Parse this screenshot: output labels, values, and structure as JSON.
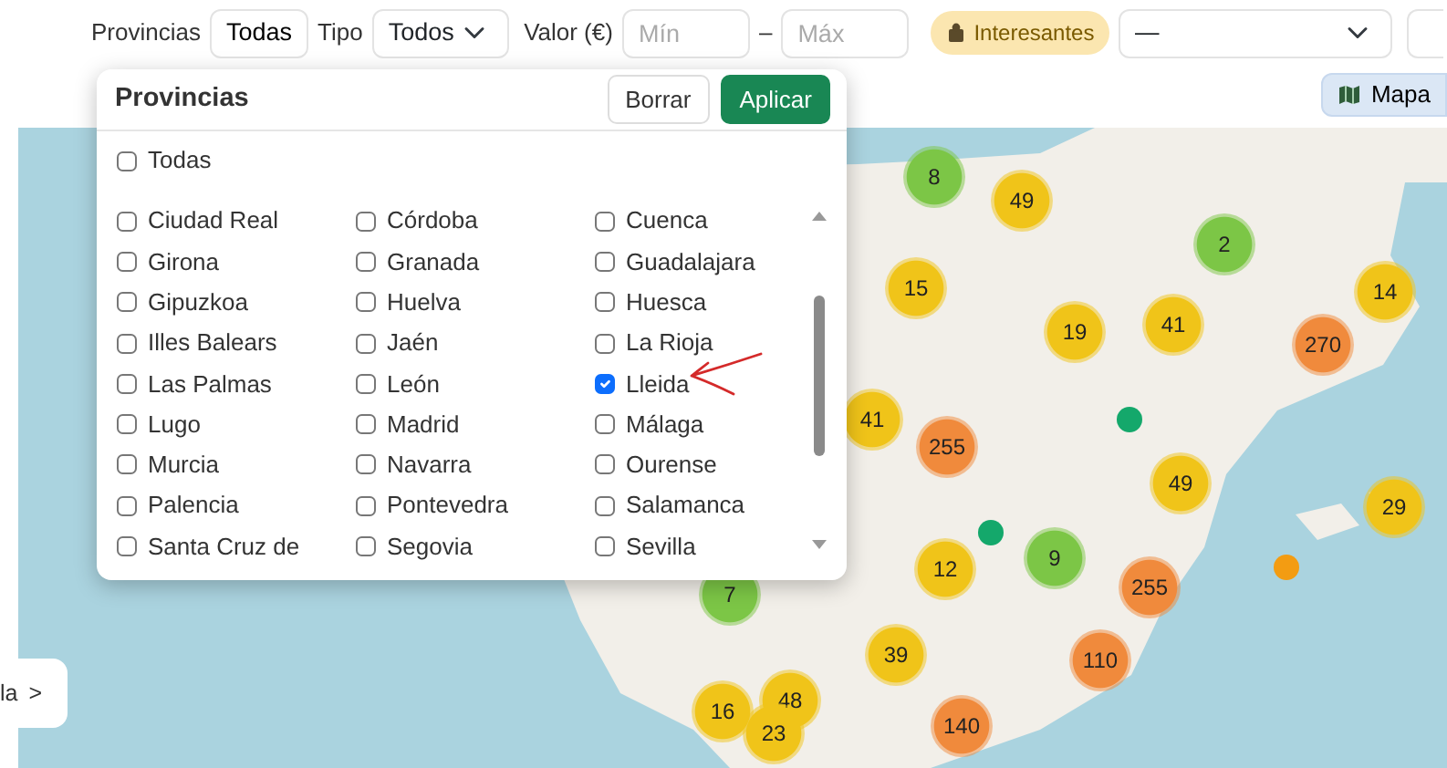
{
  "toolbar": {
    "provinces_label": "Provincias",
    "provinces_button": "Todas",
    "type_label": "Tipo",
    "type_select": "Todos",
    "value_label": "Valor (€)",
    "min_placeholder": "Mín",
    "range_separator": "–",
    "max_placeholder": "Máx",
    "interesting_badge": "Interesantes",
    "sort_select": "—"
  },
  "map_button": "Mapa",
  "provinces_panel": {
    "title": "Provincias",
    "buttons": [
      {
        "label": "Borrar",
        "kind": "secondary"
      },
      {
        "label": "Aplicar",
        "kind": "primary"
      }
    ],
    "all_option": {
      "label": "Todas",
      "checked": false
    },
    "options": [
      {
        "label": "Ciudad Real",
        "checked": false
      },
      {
        "label": "Córdoba",
        "checked": false
      },
      {
        "label": "Cuenca",
        "checked": false
      },
      {
        "label": "Girona",
        "checked": false
      },
      {
        "label": "Granada",
        "checked": false
      },
      {
        "label": "Guadalajara",
        "checked": false
      },
      {
        "label": "Gipuzkoa",
        "checked": false
      },
      {
        "label": "Huelva",
        "checked": false
      },
      {
        "label": "Huesca",
        "checked": false
      },
      {
        "label": "Illes Balears",
        "checked": false
      },
      {
        "label": "Jaén",
        "checked": false
      },
      {
        "label": "La Rioja",
        "checked": false
      },
      {
        "label": "Las Palmas",
        "checked": false
      },
      {
        "label": "León",
        "checked": false
      },
      {
        "label": "Lleida",
        "checked": true
      },
      {
        "label": "Lugo",
        "checked": false
      },
      {
        "label": "Madrid",
        "checked": false
      },
      {
        "label": "Málaga",
        "checked": false
      },
      {
        "label": "Murcia",
        "checked": false
      },
      {
        "label": "Navarra",
        "checked": false
      },
      {
        "label": "Ourense",
        "checked": false
      },
      {
        "label": "Palencia",
        "checked": false
      },
      {
        "label": "Pontevedra",
        "checked": false
      },
      {
        "label": "Salamanca",
        "checked": false
      },
      {
        "label": "Santa Cruz de",
        "checked": false
      },
      {
        "label": "Segovia",
        "checked": false
      },
      {
        "label": "Sevilla",
        "checked": false
      }
    ]
  },
  "map_markers": [
    {
      "kind": "cluster",
      "label": "8",
      "color": "#7cc646"
    },
    {
      "kind": "cluster",
      "label": "49",
      "color": "#f0c419"
    },
    {
      "kind": "cluster",
      "label": "2",
      "color": "#7cc646"
    },
    {
      "kind": "cluster",
      "label": "15",
      "color": "#f0c419"
    },
    {
      "kind": "cluster",
      "label": "14",
      "color": "#f0c419"
    },
    {
      "kind": "cluster",
      "label": "19",
      "color": "#f0c419"
    },
    {
      "kind": "cluster",
      "label": "41",
      "color": "#f0c419"
    },
    {
      "kind": "cluster",
      "label": "270",
      "color": "#f08a3c"
    },
    {
      "kind": "cluster",
      "label": "41",
      "color": "#f0c419"
    },
    {
      "kind": "cluster",
      "label": "255",
      "color": "#f08a3c"
    },
    {
      "kind": "point",
      "color": "#14a86b"
    },
    {
      "kind": "cluster",
      "label": "49",
      "color": "#f0c419"
    },
    {
      "kind": "cluster",
      "label": "29",
      "color": "#f0c419"
    },
    {
      "kind": "point",
      "color": "#14a86b"
    },
    {
      "kind": "cluster",
      "label": "7",
      "color": "#7cc646"
    },
    {
      "kind": "cluster",
      "label": "12",
      "color": "#f0c419"
    },
    {
      "kind": "cluster",
      "label": "9",
      "color": "#7cc646"
    },
    {
      "kind": "cluster",
      "label": "255",
      "color": "#f08a3c"
    },
    {
      "kind": "point",
      "color": "#f39c12"
    },
    {
      "kind": "cluster",
      "label": "39",
      "color": "#f0c419"
    },
    {
      "kind": "cluster",
      "label": "110",
      "color": "#f08a3c"
    },
    {
      "kind": "cluster",
      "label": "16",
      "color": "#f0c419"
    },
    {
      "kind": "cluster",
      "label": "48",
      "color": "#f0c419"
    },
    {
      "kind": "cluster",
      "label": "23",
      "color": "#f0c419"
    },
    {
      "kind": "cluster",
      "label": "140",
      "color": "#f08a3c"
    }
  ],
  "side_tab": {
    "label": "la",
    "arrow": ">"
  }
}
